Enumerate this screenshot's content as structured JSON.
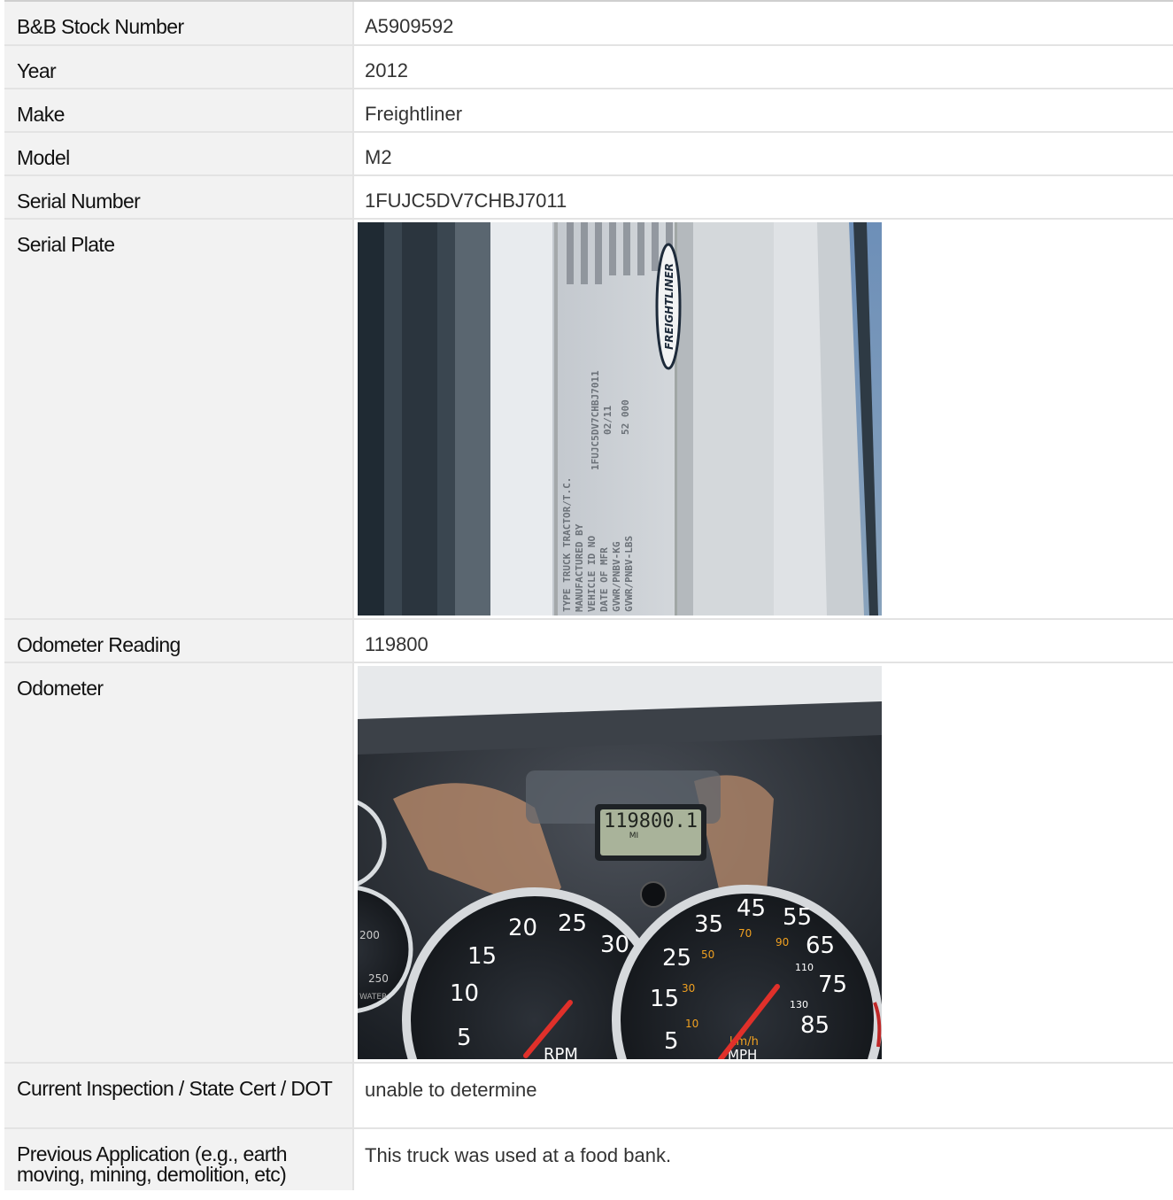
{
  "rows": [
    {
      "label": "B&B Stock Number",
      "value": "A5909592"
    },
    {
      "label": "Year",
      "value": "2012"
    },
    {
      "label": "Make",
      "value": "Freightliner"
    },
    {
      "label": "Model",
      "value": "M2"
    },
    {
      "label": "Serial Number",
      "value": "1FUJC5DV7CHBJ7011"
    }
  ],
  "serial_plate": {
    "label": "Serial Plate",
    "photo": {
      "brand": "FREIGHTLINER",
      "plate_lines": [
        "TYPE TRUCK TRACTOR/T.C.",
        "MANUFACTURED BY",
        "VEHICLE ID NO",
        "DATE OF MFR",
        "GVWR/PNBV-KG",
        "GVWR/PNBV-LBS"
      ],
      "vin_text": "1FUJC5DV7CHBJ7011",
      "date_text": "02/11",
      "gvwr_text": "52 000"
    }
  },
  "odometer_reading": {
    "label": "Odometer Reading",
    "value": "119800"
  },
  "odometer": {
    "label": "Odometer",
    "photo": {
      "lcd_value": "119800.1",
      "lcd_unit": "MI",
      "rpm_ticks": [
        "5",
        "10",
        "15",
        "20",
        "25",
        "30"
      ],
      "rpm_label": "RPM",
      "mph_ticks": [
        "5",
        "15",
        "25",
        "35",
        "45",
        "55",
        "65",
        "75",
        "85"
      ],
      "kmh_ticks": [
        "10",
        "30",
        "50",
        "70",
        "90",
        "110",
        "130"
      ],
      "speed_units": "km/h",
      "speed_label": "MPH",
      "temp_ticks": [
        "200",
        "250"
      ],
      "temp_label": "WATER"
    }
  },
  "inspection": {
    "label": "Current Inspection / State Cert / DOT",
    "value": "unable to determine"
  },
  "previous_application": {
    "label": "Previous Application (e.g., earth moving, mining, demolition, etc)",
    "value": "This truck was used at a food bank."
  }
}
